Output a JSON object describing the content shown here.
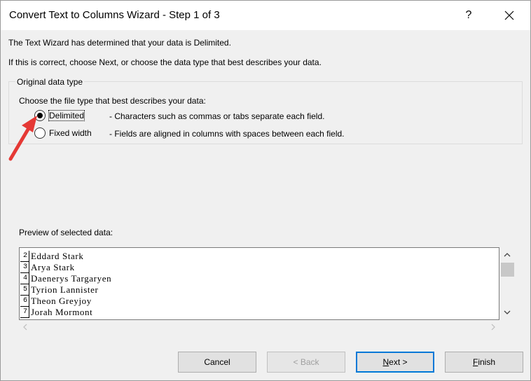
{
  "window": {
    "title": "Convert Text to Columns Wizard - Step 1 of 3",
    "help_label": "?",
    "close_label": "✕"
  },
  "intro": {
    "line1": "The Text Wizard has determined that your data is Delimited.",
    "line2": "If this is correct, choose Next, or choose the data type that best describes your data."
  },
  "data_type_group": {
    "legend": "Original data type",
    "prompt": "Choose the file type that best describes your data:",
    "options": [
      {
        "label": "Delimited",
        "description": "- Characters such as commas or tabs separate each field.",
        "selected": true
      },
      {
        "label": "Fixed width",
        "description": "- Fields are aligned in columns with spaces between each field.",
        "selected": false
      }
    ]
  },
  "preview": {
    "label": "Preview of selected data:",
    "rows": [
      {
        "num": "2",
        "text": "Eddard Stark"
      },
      {
        "num": "3",
        "text": "Arya Stark"
      },
      {
        "num": "4",
        "text": "Daenerys Targaryen"
      },
      {
        "num": "5",
        "text": "Tyrion Lannister"
      },
      {
        "num": "6",
        "text": "Theon Greyjoy"
      },
      {
        "num": "7",
        "text": "Jorah Mormont"
      }
    ]
  },
  "buttons": {
    "cancel": "Cancel",
    "back": "< Back",
    "next_prefix": "N",
    "next_rest": "ext >",
    "finish_prefix": "F",
    "finish_rest": "inish"
  },
  "colors": {
    "accent": "#0078d7",
    "arrow": "#e53935"
  }
}
